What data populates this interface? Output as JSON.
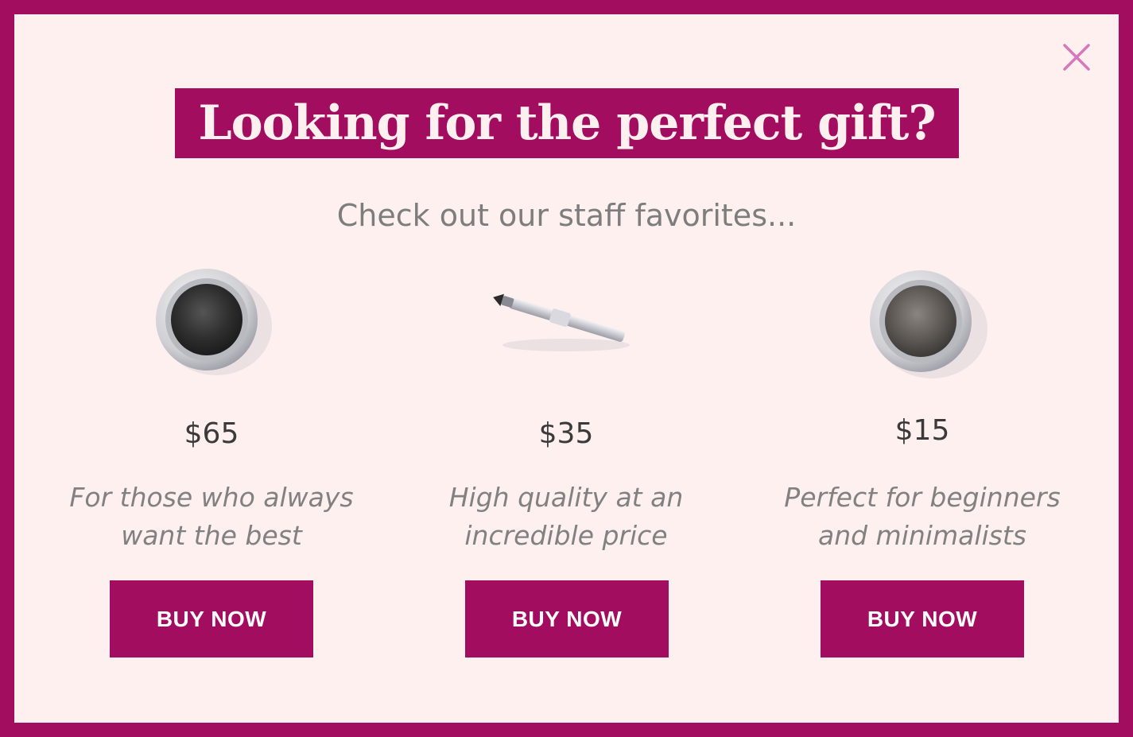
{
  "popup": {
    "headline": "Looking for the perfect gift?",
    "subheadline": "Check out our staff favorites...",
    "close_icon": "close-icon",
    "colors": {
      "border": "#a30d60",
      "background": "#fdf0ee",
      "close": "#d579b9",
      "button": "#a30d60",
      "button_text": "#ffffff",
      "price_text": "#3a3a3a",
      "desc_text": "#818181"
    }
  },
  "products": [
    {
      "image": "eyeshadow-pot-black",
      "price": "$65",
      "desc_line1": "For those who always",
      "desc_line2": "want the best",
      "button_label": "BUY NOW"
    },
    {
      "image": "eyeliner-pencil",
      "price": "$35",
      "desc_line1": "High quality at an",
      "desc_line2": "incredible price",
      "button_label": "BUY NOW"
    },
    {
      "image": "eyeshadow-pot-gray",
      "price": "$15",
      "desc_line1": "Perfect for beginners",
      "desc_line2": "and minimalists",
      "button_label": "BUY NOW"
    }
  ]
}
